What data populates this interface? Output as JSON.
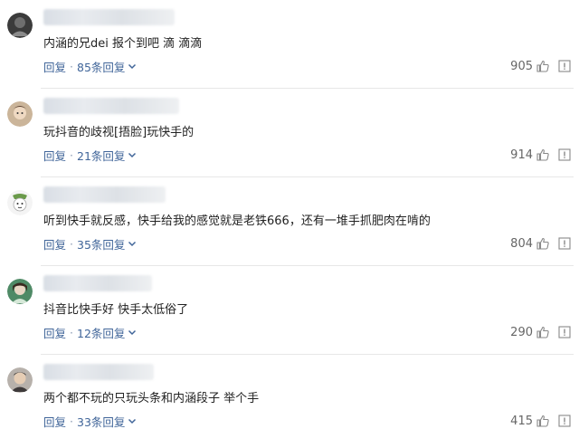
{
  "comments": [
    {
      "avatar": "avatar-dark-icon",
      "text": "内涵的兄dei 报个到吧 滴 滴滴",
      "reply_label": "回复",
      "replies_label": "85条回复",
      "likes": "905"
    },
    {
      "avatar": "avatar-face-icon",
      "text": "玩抖音的歧视[捂脸]玩快手的",
      "reply_label": "回复",
      "replies_label": "21条回复",
      "likes": "914"
    },
    {
      "avatar": "avatar-cartoon-icon",
      "text": "听到快手就反感，快手给我的感觉就是老铁666，还有一堆手抓肥肉在啃的",
      "reply_label": "回复",
      "replies_label": "35条回复",
      "likes": "804"
    },
    {
      "avatar": "avatar-green-icon",
      "text": "抖音比快手好 快手太低俗了",
      "reply_label": "回复",
      "replies_label": "12条回复",
      "likes": "290"
    },
    {
      "avatar": "avatar-person-icon",
      "text": "两个都不玩的只玩头条和内涵段子 举个手",
      "reply_label": "回复",
      "replies_label": "33条回复",
      "likes": "415"
    }
  ],
  "colors": {
    "link": "#406599",
    "text": "#222222",
    "meta": "#666666",
    "divider": "#e7e7e7"
  }
}
